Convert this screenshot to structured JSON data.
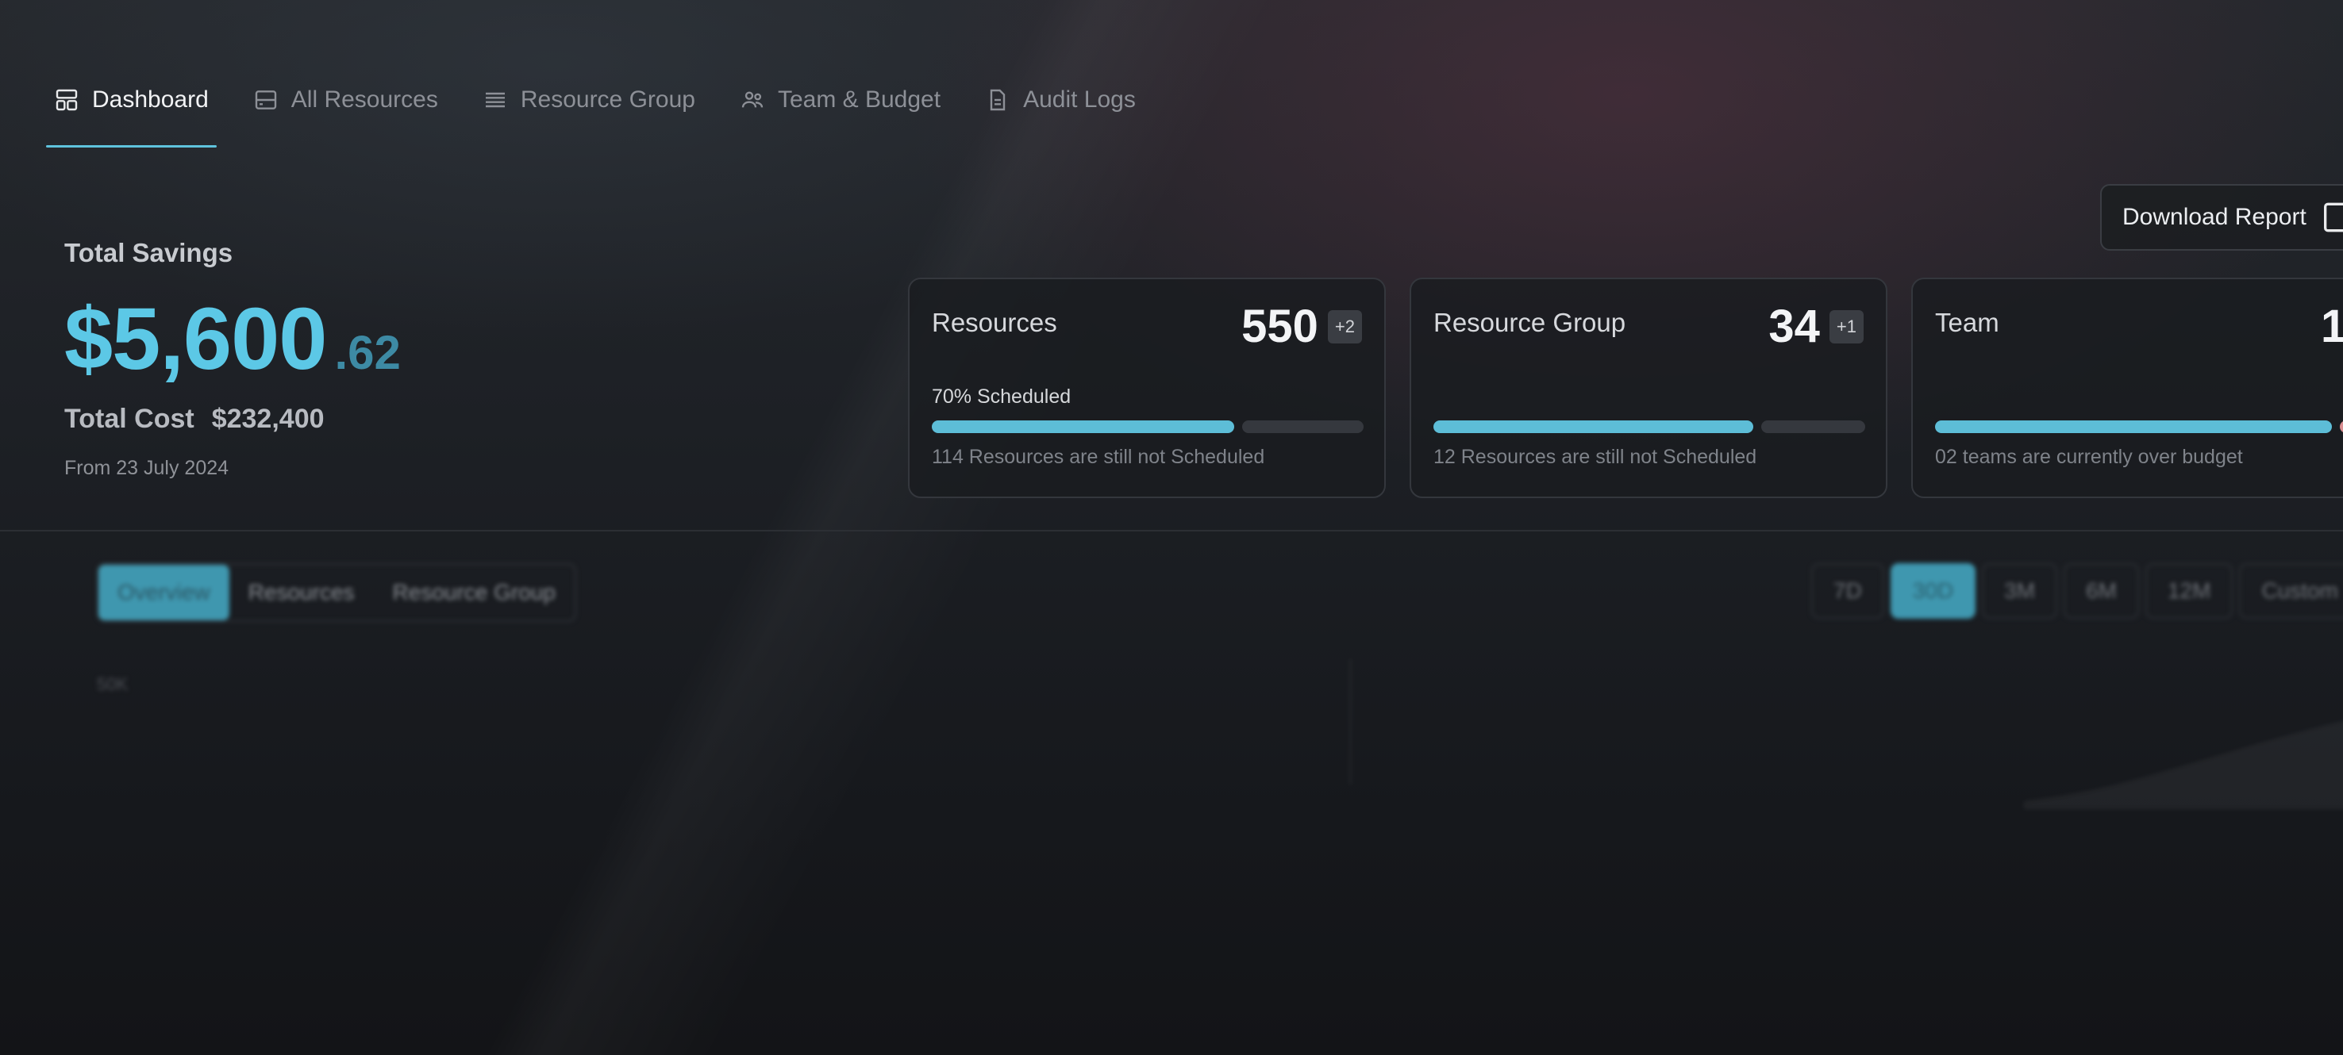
{
  "nav": {
    "items": [
      {
        "label": "Dashboard",
        "icon": "dashboard-icon",
        "active": true
      },
      {
        "label": "All Resources",
        "icon": "server-icon",
        "active": false
      },
      {
        "label": "Resource Group",
        "icon": "list-icon",
        "active": false
      },
      {
        "label": "Team & Budget",
        "icon": "users-icon",
        "active": false
      },
      {
        "label": "Audit Logs",
        "icon": "file-icon",
        "active": false
      }
    ]
  },
  "header": {
    "download_label": "Download Report"
  },
  "summary": {
    "savings_label": "Total Savings",
    "savings_integer": "$5,600",
    "savings_decimal": ".62",
    "cost_label": "Total Cost",
    "cost_value": "$232,400",
    "from_label": "From 23 July 2024"
  },
  "cards": [
    {
      "title": "Resources",
      "value": "550",
      "badge": "+2",
      "subtitle": "70% Scheduled",
      "progress": 0.7,
      "note": "114 Resources are still not Scheduled"
    },
    {
      "title": "Resource Group",
      "value": "34",
      "badge": "+1",
      "subtitle": "",
      "progress": 0.74,
      "note": "12 Resources are still not Scheduled"
    },
    {
      "title": "Team",
      "value": "1",
      "badge": "",
      "subtitle": "",
      "progress": 0.92,
      "note": "02 teams are currently over budget"
    }
  ],
  "tabs": [
    {
      "label": "Overview",
      "active": true
    },
    {
      "label": "Resources",
      "active": false
    },
    {
      "label": "Resource Group",
      "active": false
    }
  ],
  "ranges": [
    {
      "label": "7D",
      "active": false
    },
    {
      "label": "30D",
      "active": true
    },
    {
      "label": "3M",
      "active": false
    },
    {
      "label": "6M",
      "active": false
    },
    {
      "label": "12M",
      "active": false
    },
    {
      "label": "Custom",
      "active": false
    }
  ],
  "chart_label": "50K",
  "colors": {
    "accent": "#5cc8e6",
    "progress": "#5dbdd7",
    "over_budget": "#d98e91"
  }
}
